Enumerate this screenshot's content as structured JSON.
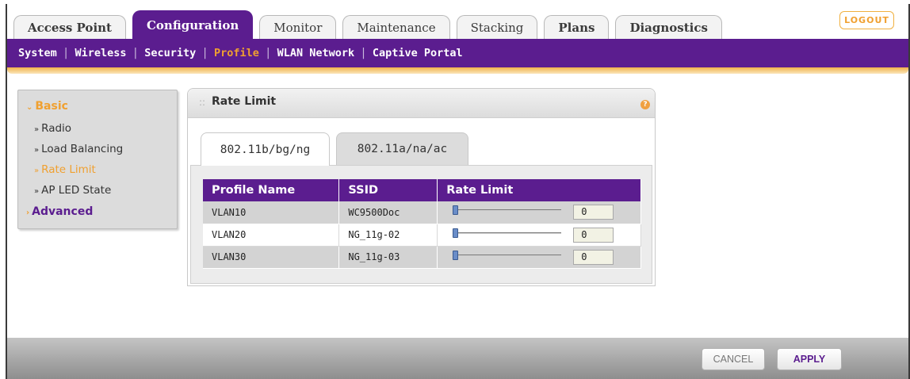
{
  "top_tabs": [
    "Access Point",
    "Configuration",
    "Monitor",
    "Maintenance",
    "Stacking",
    "Plans",
    "Diagnostics"
  ],
  "active_top_tab": "Configuration",
  "logout_label": "LOGOUT",
  "sub_nav": [
    "System",
    "Wireless",
    "Security",
    "Profile",
    "WLAN Network",
    "Captive Portal"
  ],
  "active_sub_nav": "Profile",
  "left_menu": {
    "basic_label": "Basic",
    "items": [
      "Radio",
      "Load Balancing",
      "Rate Limit",
      "AP LED State"
    ],
    "active_item": "Rate Limit",
    "advanced_label": "Advanced"
  },
  "panel": {
    "title": "Rate Limit",
    "help_glyph": "?",
    "tabs": [
      "802.11b/bg/ng",
      "802.11a/na/ac"
    ],
    "active_tab": "802.11b/bg/ng",
    "table": {
      "headers": [
        "Profile Name",
        "SSID",
        "Rate Limit"
      ],
      "rows": [
        {
          "profile": "VLAN10",
          "ssid": "WC9500Doc",
          "rate_limit": "0",
          "slider_fraction": 0.0
        },
        {
          "profile": "VLAN20",
          "ssid": "NG_11g-02",
          "rate_limit": "0",
          "slider_fraction": 0.0
        },
        {
          "profile": "VLAN30",
          "ssid": "NG_11g-03",
          "rate_limit": "0",
          "slider_fraction": 0.0
        }
      ]
    }
  },
  "footer": {
    "cancel_label": "CANCEL",
    "apply_label": "APPLY"
  },
  "colors": {
    "brand_purple": "#5b1d8f",
    "accent_orange": "#f0a030"
  }
}
